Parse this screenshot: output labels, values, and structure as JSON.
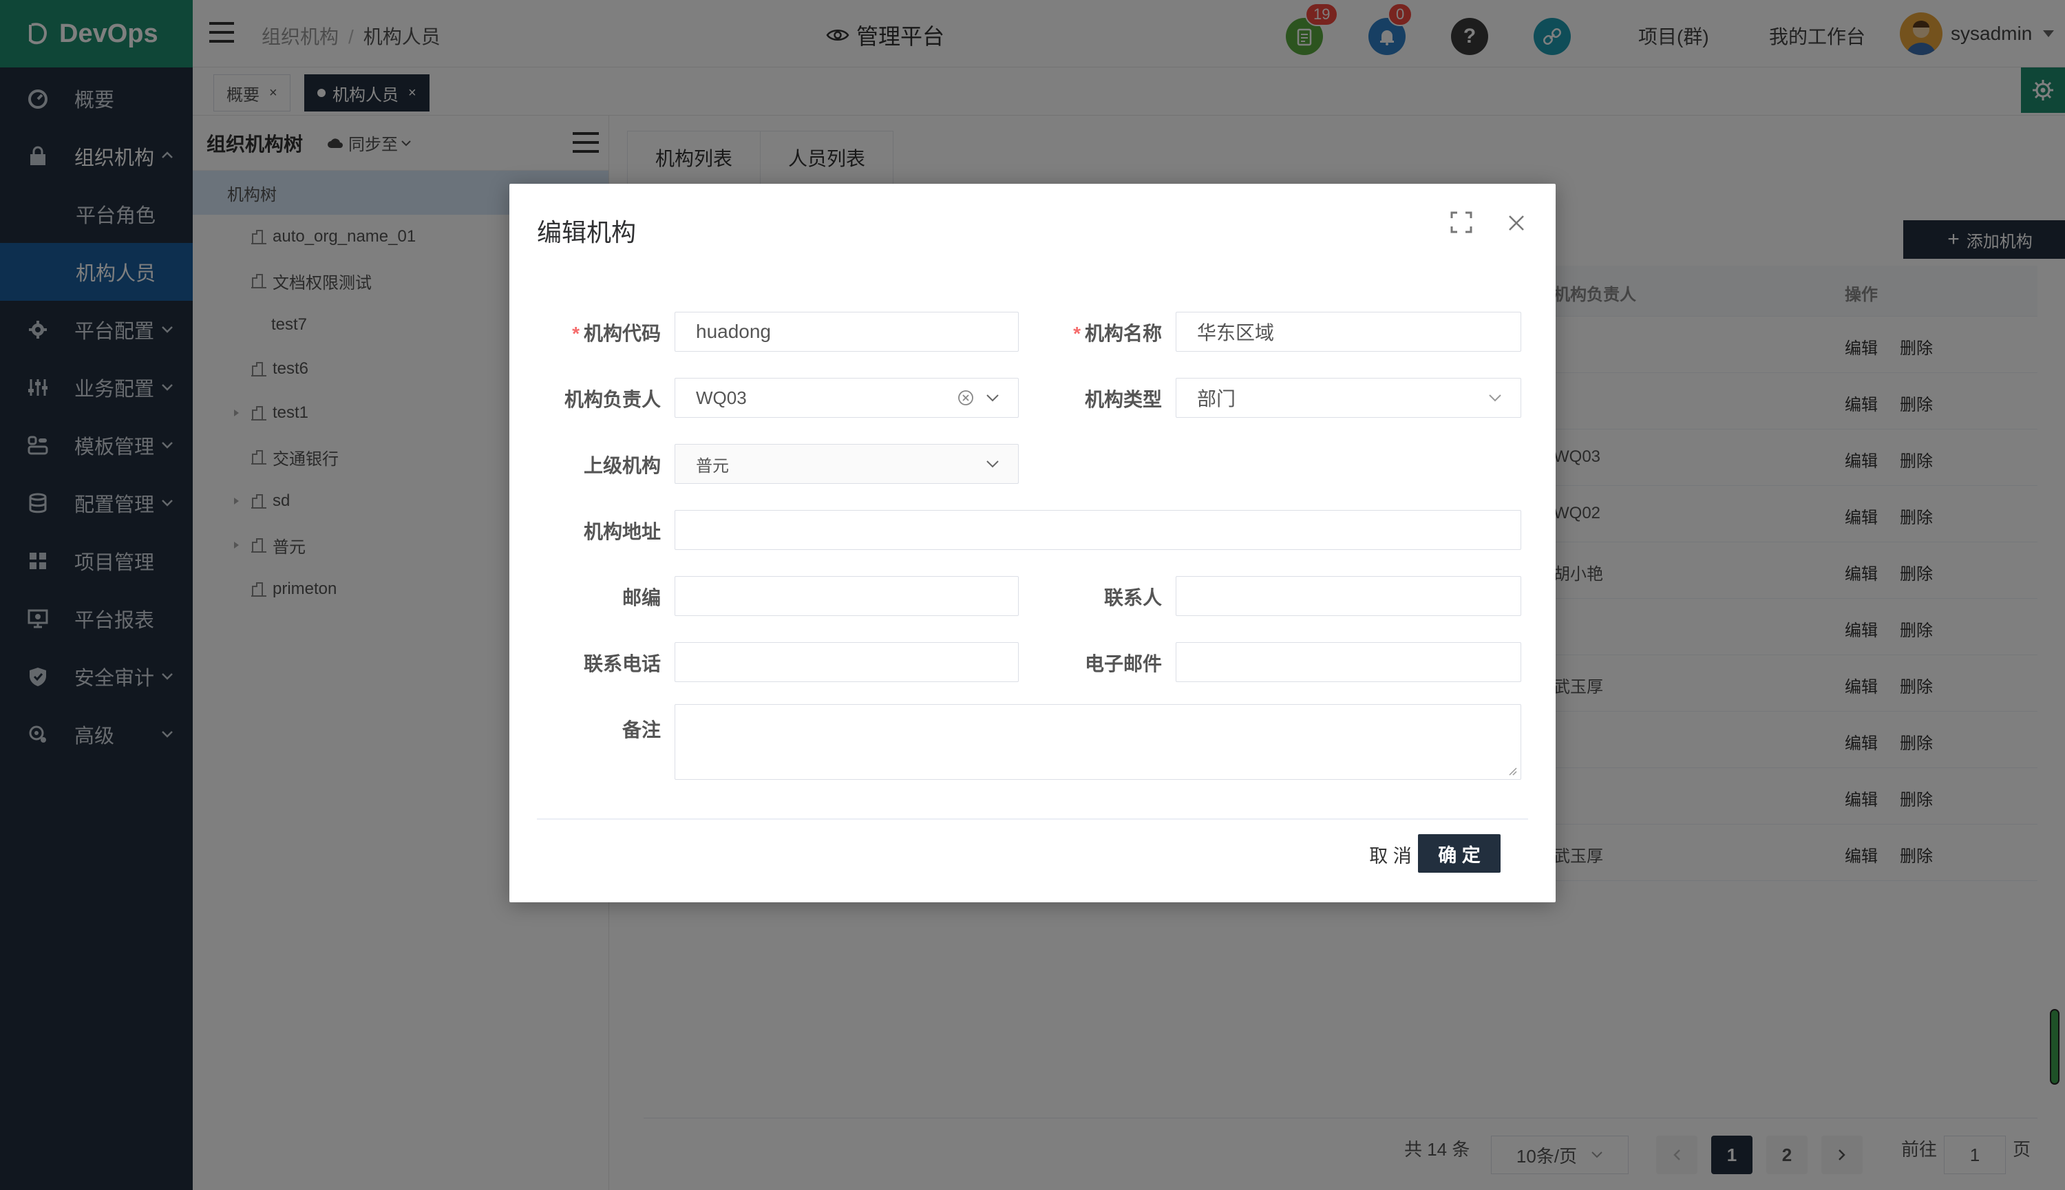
{
  "colors": {
    "brand": "#1e8c6f",
    "sidebar": "#222f3e",
    "active_menu": "#1a5f9e",
    "primary_button": "#222f3e",
    "danger_badge": "#f0483e"
  },
  "sidebar": {
    "logo": "DevOps",
    "items": [
      {
        "label": "概要",
        "icon": "dashboard-icon"
      },
      {
        "label": "组织机构",
        "icon": "lock-icon",
        "expanded": true
      },
      {
        "label": "平台角色"
      },
      {
        "label": "机构人员",
        "active": true
      },
      {
        "label": "平台配置",
        "icon": "gear-icon"
      },
      {
        "label": "业务配置",
        "icon": "sliders-icon"
      },
      {
        "label": "模板管理",
        "icon": "template-icon"
      },
      {
        "label": "配置管理",
        "icon": "database-icon"
      },
      {
        "label": "项目管理",
        "icon": "grid-icon"
      },
      {
        "label": "平台报表",
        "icon": "monitor-icon"
      },
      {
        "label": "安全审计",
        "icon": "shield-icon"
      },
      {
        "label": "高级",
        "icon": "advanced-icon"
      }
    ]
  },
  "header": {
    "breadcrumb": [
      "组织机构",
      "机构人员"
    ],
    "platform": "管理平台",
    "badges": {
      "tasks": "19",
      "notifications": "0"
    },
    "help": "?",
    "project_group": "项目(群)",
    "workspace": "我的工作台",
    "username": "sysadmin"
  },
  "page_tabs": [
    {
      "label": "概要"
    },
    {
      "label": "机构人员",
      "active": true
    }
  ],
  "tree": {
    "title": "组织机构树",
    "sync": "同步至",
    "root": "机构树",
    "nodes": [
      "auto_org_name_01",
      "文档权限测试",
      "test7",
      "test6",
      "test1",
      "交通银行",
      "sd",
      "普元",
      "primeton"
    ]
  },
  "content": {
    "tabs": [
      "机构列表",
      "人员列表"
    ],
    "add_button": "添加机构",
    "columns": {
      "owner": "机构负责人",
      "actions": "操作"
    },
    "rows": [
      {
        "owner": ""
      },
      {
        "owner": ""
      },
      {
        "owner": "WQ03"
      },
      {
        "owner": "WQ02"
      },
      {
        "owner": "胡小艳"
      },
      {
        "owner": ""
      },
      {
        "owner": "武玉厚"
      },
      {
        "owner": ""
      },
      {
        "owner": ""
      },
      {
        "owner": "武玉厚"
      }
    ],
    "edit": "编辑",
    "delete": "删除",
    "pagination": {
      "total": "共 14 条",
      "page_size": "10条/页",
      "pages": [
        "1",
        "2"
      ],
      "goto_label": "前往",
      "goto_value": "1",
      "page_unit": "页"
    }
  },
  "modal": {
    "title": "编辑机构",
    "fields": {
      "code": {
        "label": "机构代码",
        "value": "huadong"
      },
      "name": {
        "label": "机构名称",
        "value": "华东区域"
      },
      "owner": {
        "label": "机构负责人",
        "value": "WQ03"
      },
      "type": {
        "label": "机构类型",
        "value": "部门"
      },
      "parent": {
        "label": "上级机构",
        "value": "普元"
      },
      "address": {
        "label": "机构地址",
        "value": ""
      },
      "zip": {
        "label": "邮编",
        "value": ""
      },
      "contact": {
        "label": "联系人",
        "value": ""
      },
      "phone": {
        "label": "联系电话",
        "value": ""
      },
      "email": {
        "label": "电子邮件",
        "value": ""
      },
      "remark": {
        "label": "备注",
        "value": ""
      }
    },
    "required_mark": "*",
    "cancel": "取 消",
    "ok": "确 定"
  }
}
